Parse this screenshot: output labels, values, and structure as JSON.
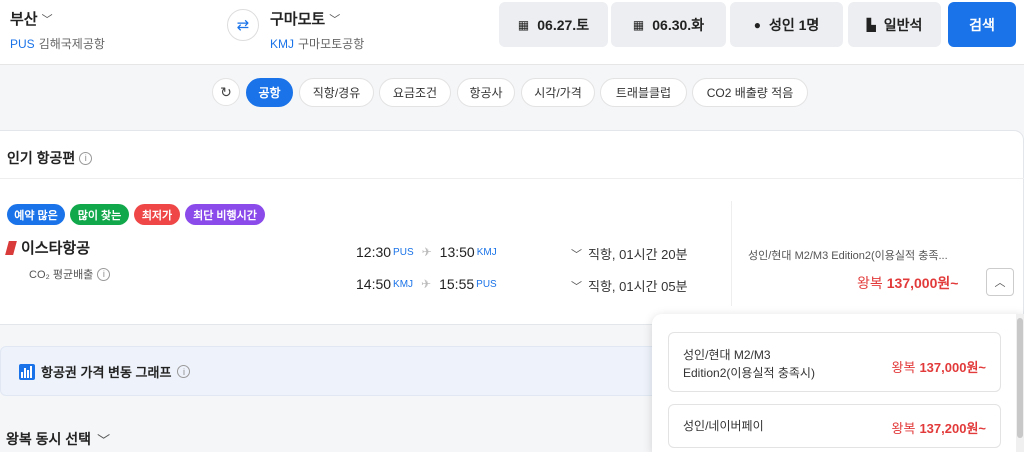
{
  "header": {
    "origin": {
      "city": "부산",
      "iata": "PUS",
      "airport": "김해국제공항"
    },
    "destination": {
      "city": "구마모토",
      "iata": "KMJ",
      "airport": "구마모토공항"
    },
    "depart_date": "06.27.토",
    "return_date": "06.30.화",
    "passengers": "성인 1명",
    "cabin": "일반석",
    "search_label": "검색"
  },
  "filters": [
    "공항",
    "직항/경유",
    "요금조건",
    "항공사",
    "시각/가격",
    "트래블클럽",
    "CO2 배출량 적음"
  ],
  "popular": {
    "title": "인기 항공편",
    "badges": [
      {
        "label": "예약 많은",
        "color": "#1a73e8"
      },
      {
        "label": "많이 찾는",
        "color": "#10a84a"
      },
      {
        "label": "최저가",
        "color": "#ef4747"
      },
      {
        "label": "최단 비행시간",
        "color": "#8a4bea"
      }
    ],
    "airline": "이스타항공",
    "co2_label": "CO₂ 평균배출",
    "legs": [
      {
        "dep_time": "12:30",
        "dep_ap": "PUS",
        "arr_time": "13:50",
        "arr_ap": "KMJ",
        "duration": "직항, 01시간 20분"
      },
      {
        "dep_time": "14:50",
        "dep_ap": "KMJ",
        "arr_time": "15:55",
        "arr_ap": "PUS",
        "duration": "직항, 01시간 05분"
      }
    ],
    "fare_desc": "성인/현대 M2/M3 Edition2(이용실적 충족...",
    "fare_prefix": "왕복",
    "fare_price": "137,000원~"
  },
  "graph": {
    "title": "항공권 가격 변동 그래프"
  },
  "roundtrip": {
    "title": "왕복 동시 선택"
  },
  "popover": {
    "options": [
      {
        "desc_line1": "성인/현대 M2/M3",
        "desc_line2": "Edition2(이용실적 충족시)",
        "prefix": "왕복",
        "price": "137,000원~"
      },
      {
        "desc_line1": "성인/네이버페이",
        "desc_line2": "",
        "prefix": "왕복",
        "price": "137,200원~"
      }
    ]
  }
}
